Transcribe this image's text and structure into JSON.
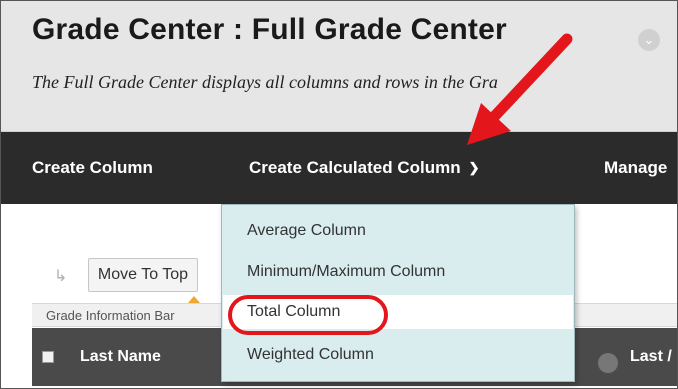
{
  "header": {
    "title": "Grade Center : Full Grade Center",
    "subtitle": "The Full Grade Center displays all columns and rows in the Gra"
  },
  "menubar": {
    "create_column": "Create Column",
    "create_calculated_column": "Create Calculated Column",
    "manage": "Manage"
  },
  "dropdown": {
    "items": [
      "Average Column",
      "Minimum/Maximum Column",
      "Total Column",
      "Weighted Column"
    ],
    "highlighted": "Total Column"
  },
  "toolbar": {
    "move_to_top": "Move To Top"
  },
  "info_bar": {
    "label": "Grade Information Bar"
  },
  "table": {
    "columns": [
      "Last Name",
      "Last /"
    ]
  },
  "colors": {
    "header_bg": "#e6e6e6",
    "menubar_bg": "#2b2b2b",
    "dropdown_bg": "#d9ecee",
    "annotation_red": "#e3161b"
  }
}
